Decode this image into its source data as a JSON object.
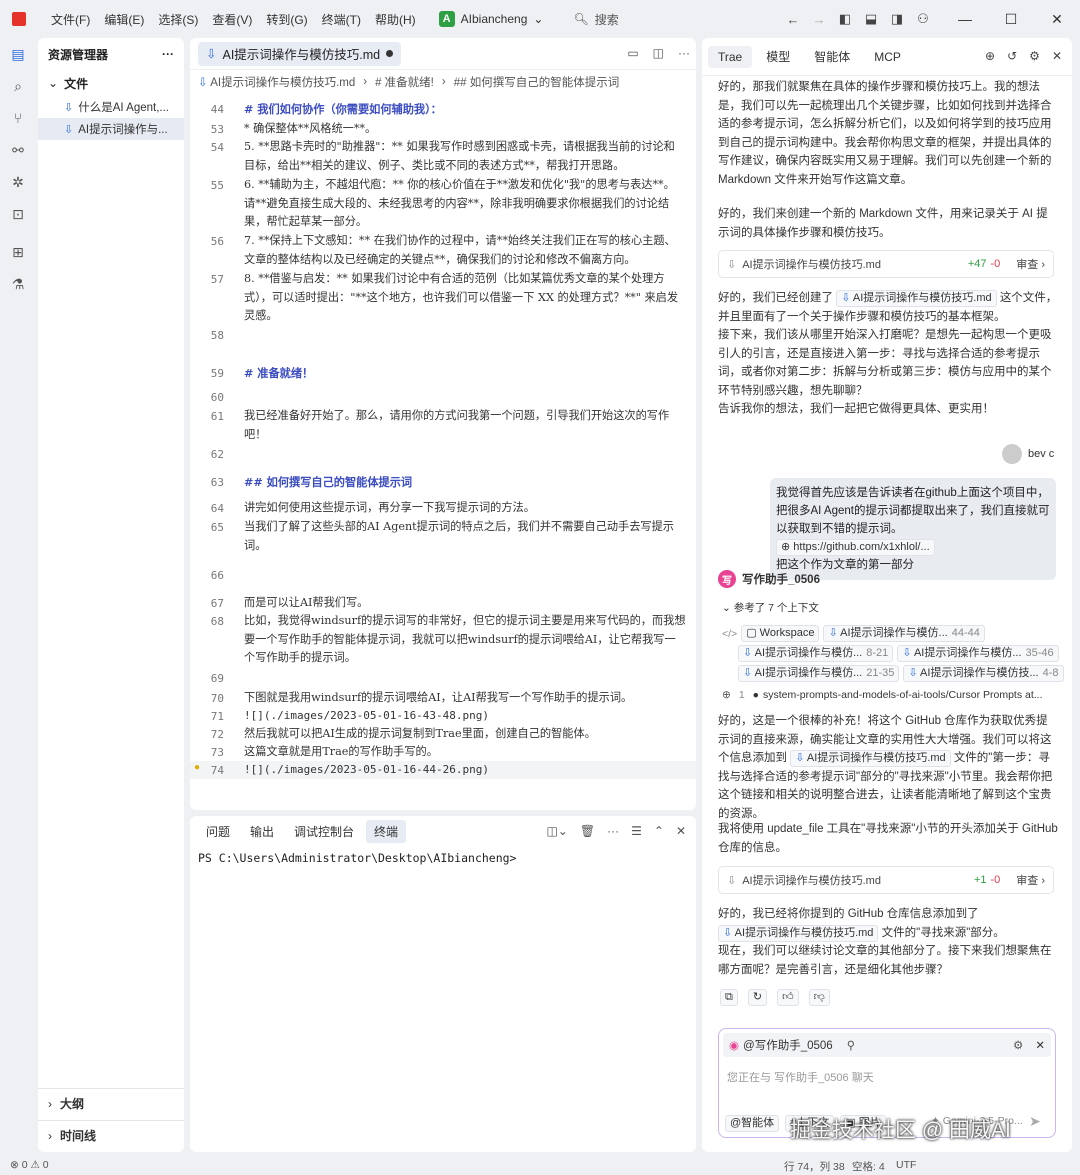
{
  "menu": [
    "文件(F)",
    "编辑(E)",
    "选择(S)",
    "查看(V)",
    "转到(G)",
    "终端(T)",
    "帮助(H)"
  ],
  "project": {
    "badge": "A",
    "name": "AIbiancheng"
  },
  "search_label": "搜索",
  "sidebar": {
    "title": "资源管理器",
    "section": "文件",
    "files": [
      "什么是AI Agent,...",
      "AI提示词操作与..."
    ],
    "outline": "大纲",
    "timeline": "时间线"
  },
  "editor": {
    "tab": "AI提示词操作与模仿技巧.md",
    "breadcrumbs": [
      "AI提示词操作与模仿技巧.md",
      "# 准备就绪!",
      "## 如何撰写自己的智能体提示词"
    ],
    "lines": [
      {
        "n": "44",
        "t": "# 我们如何协作（你需要如何辅助我）："
      },
      {
        "n": "53",
        "t": "    *   确保整体**风格统一**。"
      },
      {
        "n": "54",
        "t": "5.  **思路卡壳时的\"助推器\"：** 如果我写作时感到困惑或卡壳，请根据我当前的讨论和目标，给出**相关的建议、例子、类比或不同的表述方式**，帮我打开思路。"
      },
      {
        "n": "55",
        "t": "6.  **辅助为主，不越俎代庖：** 你的核心价值在于**激发和优化\"我\"的思考与表达**。请**避免直接生成大段的、未经我思考的内容**，除非我明确要求你根据我们的讨论结果，帮忙起草某一部分。"
      },
      {
        "n": "56",
        "t": "7.  **保持上下文感知：** 在我们协作的过程中，请**始终关注我们正在写的核心主题、文章的整体结构以及已经确定的关键点**，确保我们的讨论和修改不偏离方向。"
      },
      {
        "n": "57",
        "t": "8.  **借鉴与启发：** 如果我们讨论中有合适的范例（比如某篇优秀文章的某个处理方式），可以适时提出：\"**这个地方，也许我们可以借鉴一下 XX 的处理方式？**\" 来启发灵感。"
      },
      {
        "n": "58",
        "t": ""
      },
      {
        "n": "59",
        "t": "# 准备就绪！"
      },
      {
        "n": "60",
        "t": ""
      },
      {
        "n": "61",
        "t": "我已经准备好开始了。那么，请用你的方式问我第一个问题，引导我们开始这次的写作吧！"
      },
      {
        "n": "62",
        "t": ""
      },
      {
        "n": "63",
        "t": "## 如何撰写自己的智能体提示词"
      },
      {
        "n": "64",
        "t": "讲完如何使用这些提示词，再分享一下我写提示词的方法。"
      },
      {
        "n": "65",
        "t": "当我们了解了这些头部的AI Agent提示词的特点之后，我们并不需要自己动手去写提示词。"
      },
      {
        "n": "66",
        "t": ""
      },
      {
        "n": "67",
        "t": "而是可以让AI帮我们写。"
      },
      {
        "n": "68",
        "t": "比如，我觉得windsurf的提示词写的非常好，但它的提示词主要是用来写代码的，而我想要一个写作助手的智能体提示词，我就可以把windsurf的提示词喂给AI，让它帮我写一个写作助手的提示词。"
      },
      {
        "n": "69",
        "t": ""
      },
      {
        "n": "70",
        "t": "下图就是我用windsurf的提示词喂给AI，让AI帮我写一个写作助手的提示词。"
      },
      {
        "n": "71",
        "t": "![](./images/2023-05-01-16-43-48.png)"
      },
      {
        "n": "72",
        "t": "然后我就可以把AI生成的提示词复制到Trae里面，创建自己的智能体。"
      },
      {
        "n": "73",
        "t": "这篇文章就是用Trae的写作助手写的。"
      },
      {
        "n": "74",
        "t": "![](./images/2023-05-01-16-44-26.png)"
      }
    ]
  },
  "terminal": {
    "tabs": [
      "问题",
      "输出",
      "调试控制台",
      "终端"
    ],
    "prompt": "PS C:\\Users\\Administrator\\Desktop\\AIbiancheng>"
  },
  "chat": {
    "tabs": [
      "Trae",
      "模型",
      "智能体",
      "MCP"
    ],
    "p1": "好的，那我们就聚焦在具体的操作步骤和模仿技巧上。我的想法是，我们可以先一起梳理出几个关键步骤，比如如何找到并选择合适的参考提示词，怎么拆解分析它们，以及如何将学到的技巧应用到自己的提示词构建中。我会帮你构思文章的框架，并提出具体的写作建议，确保内容既实用又易于理解。我们可以先创建一个新的 Markdown 文件来开始写作这篇文章。",
    "p2": "好的，我们来创建一个新的 Markdown 文件，用来记录关于 AI 提示词的具体操作步骤和模仿技巧。",
    "file1": {
      "name": "AI提示词操作与模仿技巧.md",
      "plus": "+47",
      "minus": "-0",
      "review": "审查"
    },
    "p3a": "好的，我们已经创建了",
    "p3chip": "AI提示词操作与模仿技巧.md",
    "p3b": "这个文件，并且里面有了一个关于操作步骤和模仿技巧的基本框架。",
    "p3c": "接下来，我们该从哪里开始深入打磨呢？是想先一起构思一个更吸引人的引言，还是直接进入第一步：寻找与选择合适的参考提示词，或者你对第二步：拆解与分析或第三步：模仿与应用中的某个环节特别感兴趣，想先聊聊？",
    "p3d": "告诉我你的想法，我们一起把它做得更具体、更实用！",
    "user_name": "bev c",
    "user_msg": "我觉得首先应该是告诉读者在github上面这个项目中，把很多AI Agent的提示词都提取出来了，我们直接就可以获取到不错的提示词。",
    "user_link": "https://github.com/x1xhlol/...",
    "user_msg2": "把这个作为文章的第一部分",
    "agent_name": "写作助手_0506",
    "ctx_label": "参考了 7 个上下文",
    "ctx": [
      {
        "name": "Workspace",
        "r": ""
      },
      {
        "name": "AI提示词操作与模仿...",
        "r": "44-44"
      },
      {
        "name": "AI提示词操作与模仿...",
        "r": "8-21"
      },
      {
        "name": "AI提示词操作与模仿...",
        "r": "35-46"
      },
      {
        "name": "AI提示词操作与模仿...",
        "r": "21-35"
      },
      {
        "name": "AI提示词操作与模仿技...",
        "r": "4-8"
      }
    ],
    "web_count": "1",
    "web_ref": "system-prompts-and-models-of-ai-tools/Cursor Prompts at...",
    "p4": "好的，这是一个很棒的补充！将这个 GitHub 仓库作为获取优秀提示词的直接来源，确实能让文章的实用性大大增强。我们可以将这个信息添加到",
    "p4chip": "AI提示词操作与模仿技巧.md",
    "p4b": "文件的\"第一步：寻找与选择合适的参考提示词\"部分的\"寻找来源\"小节里。我会帮你把这个链接和相关的说明整合进去，让读者能清晰地了解到这个宝贵的资源。",
    "p5": "我将使用 update_file 工具在\"寻找来源\"小节的开头添加关于 GitHub 仓库的信息。",
    "file2": {
      "name": "AI提示词操作与模仿技巧.md",
      "plus": "+1",
      "minus": "-0",
      "review": "审查"
    },
    "p6a": "好的，我已经将你提到的 GitHub 仓库信息添加到了",
    "p6chip": "AI提示词操作与模仿技巧.md",
    "p6b": "文件的\"寻找来源\"部分。",
    "p6c": "现在，我们可以继续讨论文章的其他部分了。接下来我们想聚焦在哪方面呢？是完善引言，还是细化其他步骤？",
    "input_agent": "@写作助手_0506",
    "input_placeholder": "您正在与 写作助手_0506 聊天",
    "input_btns": [
      "@智能体",
      "#上下文",
      "图片"
    ],
    "model": "Gemini-2.5-Pro..."
  },
  "status": {
    "left": "⊗ 0 ⚠ 0",
    "pos": "行 74，列 38",
    "spaces": "空格: 4",
    "enc": "UTF"
  },
  "watermark": "掘金技术社区 @ 田威AI"
}
